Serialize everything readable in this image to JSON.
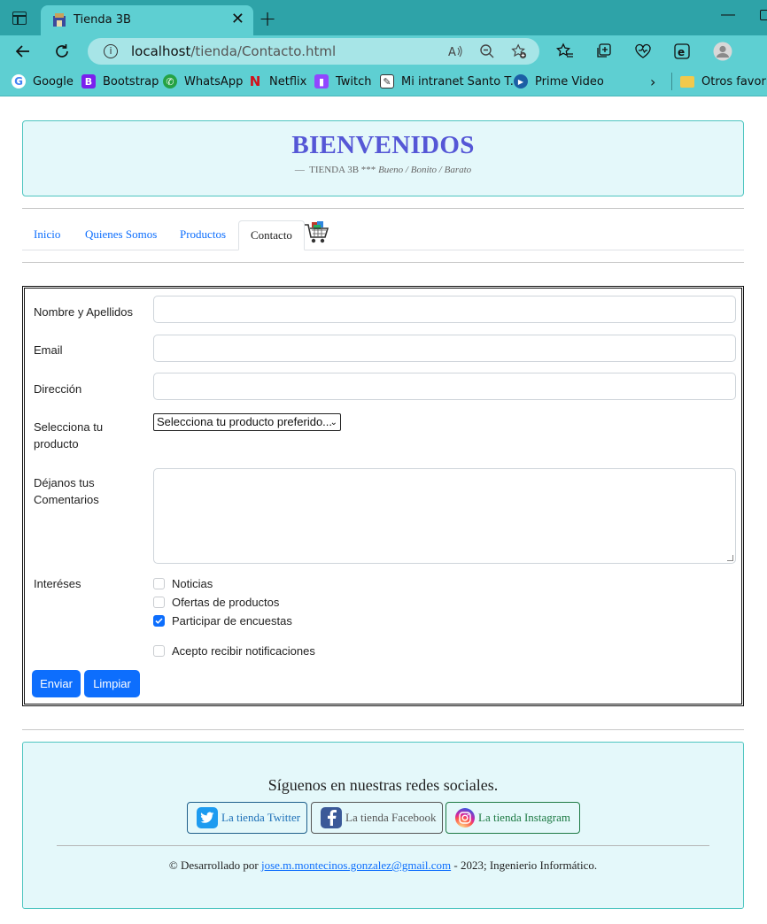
{
  "browser": {
    "tab_title": "Tienda 3B",
    "url_host": "localhost",
    "url_path": "/tienda/Contacto.html",
    "bookmarks": [
      "Google",
      "Bootstrap",
      "WhatsApp",
      "Netflix",
      "Twitch",
      "Mi intranet Santo T...",
      "Prime Video"
    ],
    "other_favorites": "Otros favoritos"
  },
  "header": {
    "title": "BIENVENIDOS",
    "subtitle_dash": "—",
    "subtitle_store": "TIENDA 3B ***",
    "subtitle_tagline": "Bueno / Bonito / Barato"
  },
  "nav": {
    "items": [
      "Inicio",
      "Quienes Somos",
      "Productos",
      "Contacto"
    ],
    "active": "Contacto"
  },
  "form": {
    "name_label": "Nombre y Apellidos",
    "email_label": "Email",
    "address_label": "Dirección",
    "product_label": "Selecciona tu producto",
    "product_select_value": "Selecciona tu producto preferido...",
    "comments_label": "Déjanos tus Comentarios",
    "interests_label": "Interéses",
    "interests": [
      {
        "label": "Noticias",
        "checked": false
      },
      {
        "label": "Ofertas de productos",
        "checked": false
      },
      {
        "label": "Participar de encuestas",
        "checked": true
      }
    ],
    "accept_label": "Acepto recibir notificaciones",
    "accept_checked": false,
    "submit_label": "Enviar",
    "reset_label": "Limpiar"
  },
  "footer": {
    "follow_text": "Síguenos en nuestras redes sociales.",
    "twitter_label": "La tienda Twitter",
    "facebook_label": "La tienda Facebook",
    "instagram_label": "La tienda Instagram",
    "credit_prefix": "© Desarrollado por",
    "credit_email": "jose.m.montecinos.gonzalez@gmail.com",
    "credit_suffix": "- 2023; Ingenierio Informático."
  },
  "colors": {
    "accent": "#0d6efd",
    "title": "#5557d6",
    "banner_bg": "#e4f8fa",
    "chrome": "#5ecfd2"
  }
}
